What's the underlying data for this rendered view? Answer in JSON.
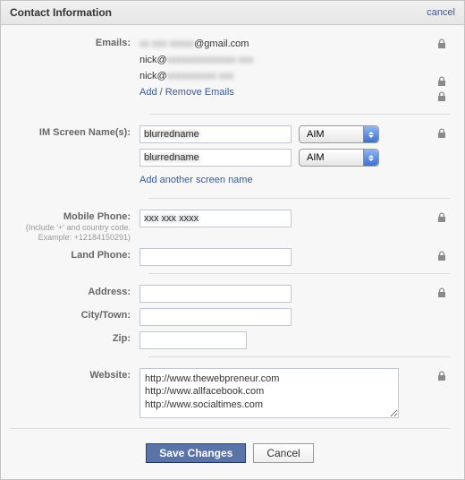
{
  "header": {
    "title": "Contact Information",
    "cancel": "cancel"
  },
  "labels": {
    "emails": "Emails:",
    "im": "IM Screen Name(s):",
    "mobile": "Mobile Phone:",
    "mobile_hint": "(Include '+' and country code. Example: +12184150291)",
    "land": "Land Phone:",
    "address": "Address:",
    "city": "City/Town:",
    "zip": "Zip:",
    "website": "Website:"
  },
  "emails": {
    "e1_masked": "xx xxx xxxxx",
    "e1_suffix": "@gmail.com",
    "e2_prefix": "nick@",
    "e2_masked": "xxxxxxxxxxxxxx xxx",
    "e3_prefix": "nick@",
    "e3_masked": "xxxxxxxxxx xxx",
    "add_remove": "Add / Remove Emails"
  },
  "im": {
    "v1": "blurredname",
    "v2": "blurredname",
    "provider1": "AIM",
    "provider2": "AIM",
    "add_another": "Add another screen name"
  },
  "phone": {
    "mobile_value": "xxx xxx xxxx"
  },
  "website": {
    "value": "http://www.thewebpreneur.com\nhttp://www.allfacebook.com\nhttp://www.socialtimes.com"
  },
  "actions": {
    "save": "Save Changes",
    "cancel": "Cancel"
  }
}
